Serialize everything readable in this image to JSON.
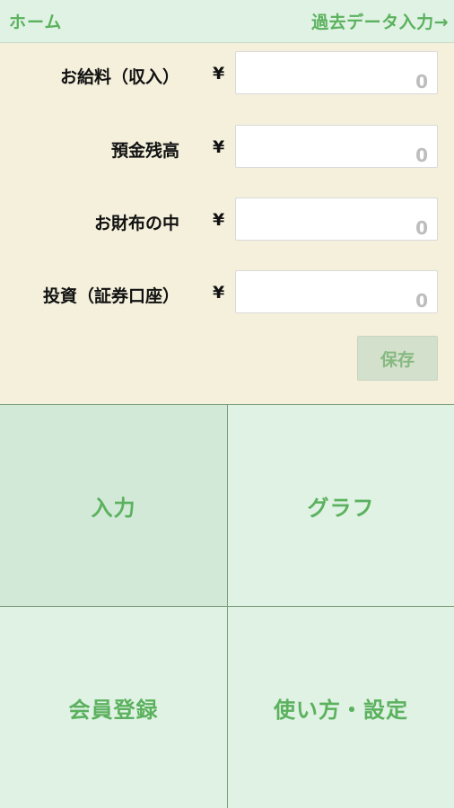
{
  "header": {
    "home_label": "ホーム",
    "past_data_link": "過去データ入力→"
  },
  "form": {
    "currency_symbol": "¥",
    "fields": [
      {
        "label": "お給料（収入）",
        "value": "0"
      },
      {
        "label": "預金残高",
        "value": "0"
      },
      {
        "label": "お財布の中",
        "value": "0"
      },
      {
        "label": "投資（証券口座）",
        "value": "0"
      }
    ],
    "save_label": "保存"
  },
  "menu": {
    "input": "入力",
    "graph": "グラフ",
    "member": "会員登録",
    "howto": "使い方・設定"
  },
  "colors": {
    "accent_green": "#5bb15d",
    "header_bg": "#dff2e4",
    "form_bg": "#f4f0dc"
  }
}
